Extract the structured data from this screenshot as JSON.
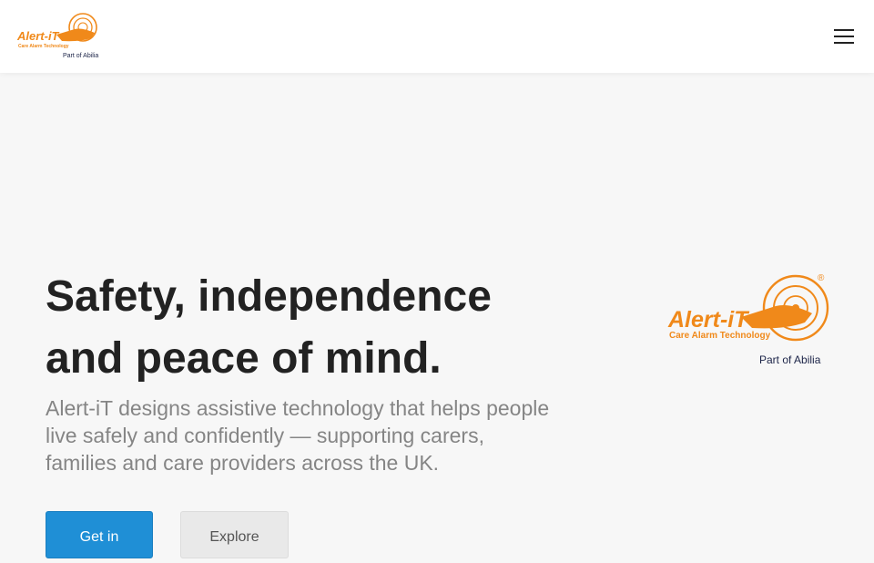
{
  "header": {
    "logo": {
      "brand": "Alert-iT",
      "tagline": "Care Alarm Technology",
      "part_of": "Part of Abilia"
    },
    "menu_icon": "hamburger-menu-icon"
  },
  "hero": {
    "title_line1": "Safety, independence",
    "title_line2": "and peace of mind.",
    "subtitle": "Alert-iT designs assistive technology that helps people live safely and confidently — supporting carers, families and care providers across the UK.",
    "primary_button": "Get in",
    "secondary_button": "Explore",
    "logo": {
      "brand": "Alert-iT",
      "tagline": "Care Alarm Technology",
      "part_of": "Part of Abilia",
      "registered": "®"
    }
  },
  "colors": {
    "brand_orange": "#f0891a",
    "navy": "#1c2448",
    "primary_blue": "#1f8fd6",
    "background": "#f7f7f7"
  }
}
